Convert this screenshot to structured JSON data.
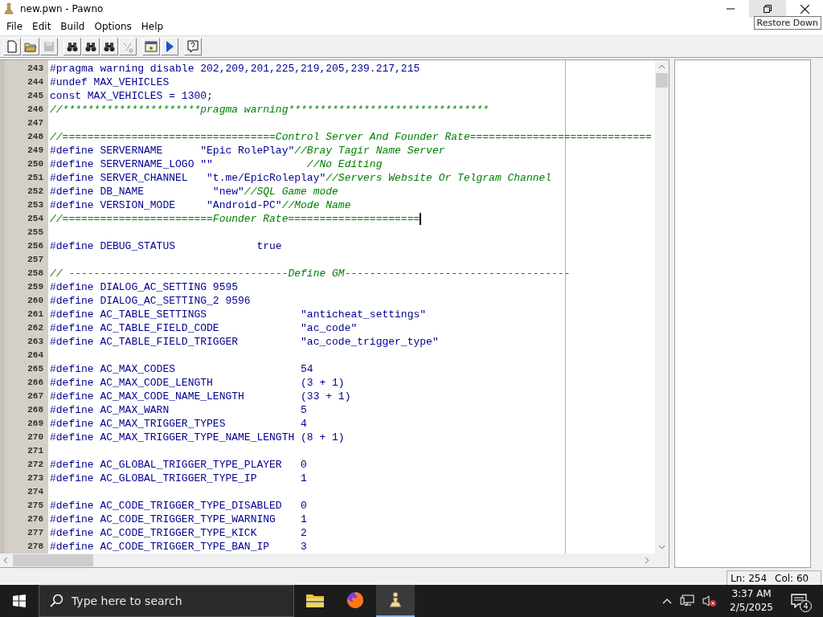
{
  "window": {
    "title": "new.pwn - Pawno",
    "tooltip": "Restore Down"
  },
  "menu": [
    {
      "label": "File"
    },
    {
      "label": "Edit"
    },
    {
      "label": "Build"
    },
    {
      "label": "Options"
    },
    {
      "label": "Help"
    }
  ],
  "toolbar": [
    {
      "kind": "new",
      "disabled": false
    },
    {
      "kind": "open",
      "disabled": false
    },
    {
      "kind": "save",
      "disabled": true
    },
    {
      "kind": "sep"
    },
    {
      "kind": "find",
      "disabled": false
    },
    {
      "kind": "find",
      "disabled": false
    },
    {
      "kind": "find",
      "disabled": false
    },
    {
      "kind": "goto",
      "disabled": false
    },
    {
      "kind": "sep"
    },
    {
      "kind": "compile",
      "disabled": false
    },
    {
      "kind": "run",
      "disabled": false
    },
    {
      "kind": "sep"
    },
    {
      "kind": "help",
      "disabled": false
    }
  ],
  "editor": {
    "lines": [
      {
        "number": "243",
        "segments": [
          {
            "kind": "code",
            "text": "#pragma warning disable 202,209,201,225,219,205,239.217,215"
          }
        ]
      },
      {
        "number": "244",
        "segments": [
          {
            "kind": "code",
            "text": "#undef MAX_VEHICLES"
          }
        ]
      },
      {
        "number": "245",
        "segments": [
          {
            "kind": "code",
            "text": "const MAX_VEHICLES = 1300;"
          }
        ]
      },
      {
        "number": "246",
        "segments": [
          {
            "kind": "comment",
            "text": "//**********************pragma warning********************************"
          }
        ]
      },
      {
        "number": "247"
      },
      {
        "number": "248",
        "segments": [
          {
            "kind": "comment",
            "text": "//==================================Control Server And Founder Rate============================="
          }
        ]
      },
      {
        "number": "249",
        "segments": [
          {
            "kind": "code",
            "text": "#define SERVERNAME      \"Epic RolePlay\""
          },
          {
            "kind": "comment",
            "text": "//Bray Tagir Name Server"
          }
        ]
      },
      {
        "number": "250",
        "segments": [
          {
            "kind": "code",
            "text": "#define SERVERNAME_LOGO \"\"               "
          },
          {
            "kind": "comment",
            "text": "//No Editing"
          }
        ]
      },
      {
        "number": "251",
        "segments": [
          {
            "kind": "code",
            "text": "#define SERVER_CHANNEL   \"t.me/EpicRoleplay\""
          },
          {
            "kind": "comment",
            "text": "//Servers Website Or Telgram Channel"
          }
        ]
      },
      {
        "number": "252",
        "segments": [
          {
            "kind": "code",
            "text": "#define DB_NAME           \"new\""
          },
          {
            "kind": "comment",
            "text": "//SQL Game mode"
          }
        ]
      },
      {
        "number": "253",
        "segments": [
          {
            "kind": "code",
            "text": "#define VERSION_MODE     \"Android-PC\""
          },
          {
            "kind": "comment",
            "text": "//Mode Name"
          }
        ]
      },
      {
        "number": "254",
        "caret": true,
        "segments": [
          {
            "kind": "comment",
            "text": "//========================Founder Rate====================="
          }
        ]
      },
      {
        "number": "255"
      },
      {
        "number": "256",
        "segments": [
          {
            "kind": "code",
            "text": "#define DEBUG_STATUS             true"
          }
        ]
      },
      {
        "number": "257"
      },
      {
        "number": "258",
        "segments": [
          {
            "kind": "comment",
            "text": "// -----------------------------------Define GM------------------------------------"
          }
        ]
      },
      {
        "number": "259",
        "segments": [
          {
            "kind": "code",
            "text": "#define DIALOG_AC_SETTING 9595"
          }
        ]
      },
      {
        "number": "260",
        "segments": [
          {
            "kind": "code",
            "text": "#define DIALOG_AC_SETTING_2 9596"
          }
        ]
      },
      {
        "number": "261",
        "segments": [
          {
            "kind": "code",
            "text": "#define AC_TABLE_SETTINGS               \"anticheat_settings\""
          }
        ]
      },
      {
        "number": "262",
        "segments": [
          {
            "kind": "code",
            "text": "#define AC_TABLE_FIELD_CODE             \"ac_code\""
          }
        ]
      },
      {
        "number": "263",
        "segments": [
          {
            "kind": "code",
            "text": "#define AC_TABLE_FIELD_TRIGGER          \"ac_code_trigger_type\""
          }
        ]
      },
      {
        "number": "264"
      },
      {
        "number": "265",
        "segments": [
          {
            "kind": "code",
            "text": "#define AC_MAX_CODES                    54"
          }
        ]
      },
      {
        "number": "266",
        "segments": [
          {
            "kind": "code",
            "text": "#define AC_MAX_CODE_LENGTH              (3 + 1)"
          }
        ]
      },
      {
        "number": "267",
        "segments": [
          {
            "kind": "code",
            "text": "#define AC_MAX_CODE_NAME_LENGTH         (33 + 1)"
          }
        ]
      },
      {
        "number": "268",
        "segments": [
          {
            "kind": "code",
            "text": "#define AC_MAX_WARN                     5"
          }
        ]
      },
      {
        "number": "269",
        "segments": [
          {
            "kind": "code",
            "text": "#define AC_MAX_TRIGGER_TYPES            4"
          }
        ]
      },
      {
        "number": "270",
        "segments": [
          {
            "kind": "code",
            "text": "#define AC_MAX_TRIGGER_TYPE_NAME_LENGTH (8 + 1)"
          }
        ]
      },
      {
        "number": "271"
      },
      {
        "number": "272",
        "segments": [
          {
            "kind": "code",
            "text": "#define AC_GLOBAL_TRIGGER_TYPE_PLAYER   0"
          }
        ]
      },
      {
        "number": "273",
        "segments": [
          {
            "kind": "code",
            "text": "#define AC_GLOBAL_TRIGGER_TYPE_IP       1"
          }
        ]
      },
      {
        "number": "274"
      },
      {
        "number": "275",
        "segments": [
          {
            "kind": "code",
            "text": "#define AC_CODE_TRIGGER_TYPE_DISABLED   0"
          }
        ]
      },
      {
        "number": "276",
        "segments": [
          {
            "kind": "code",
            "text": "#define AC_CODE_TRIGGER_TYPE_WARNING    1"
          }
        ]
      },
      {
        "number": "277",
        "segments": [
          {
            "kind": "code",
            "text": "#define AC_CODE_TRIGGER_TYPE_KICK       2"
          }
        ]
      },
      {
        "number": "278",
        "segments": [
          {
            "kind": "code",
            "text": "#define AC_CODE_TRIGGER_TYPE_BAN_IP     3"
          }
        ]
      }
    ]
  },
  "status_bar": {
    "line": "Ln: 254",
    "column": "Col: 60"
  },
  "taskbar": {
    "search_placeholder": "Type here to search",
    "apps": [
      {
        "kind": "folder",
        "selected": false
      },
      {
        "kind": "browser",
        "selected": false
      },
      {
        "kind": "pawno",
        "selected": true
      }
    ],
    "time": "3:37 AM",
    "date": "2/5/2025",
    "notifications": "4"
  }
}
